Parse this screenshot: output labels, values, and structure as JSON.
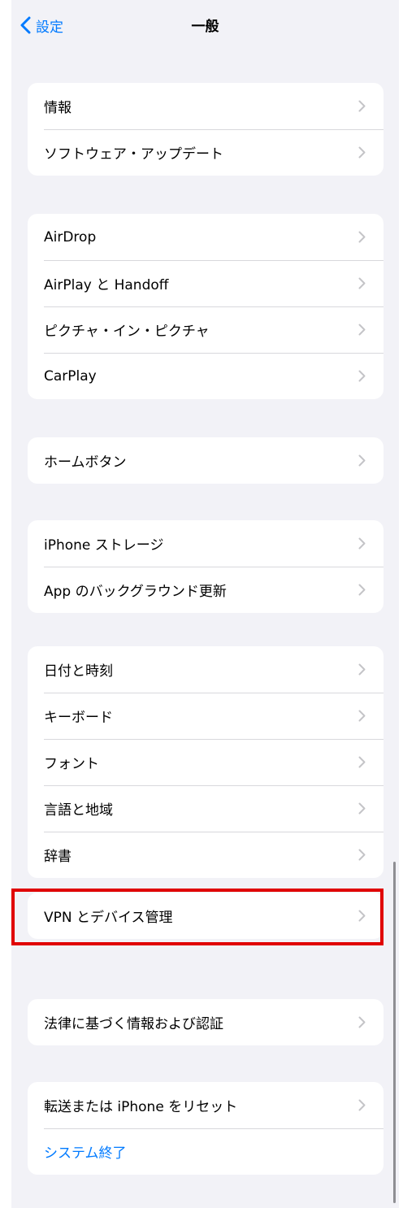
{
  "nav": {
    "back_label": "設定",
    "title": "一般"
  },
  "groups": [
    {
      "items": [
        "情報",
        "ソフトウェア・アップデート"
      ]
    },
    {
      "items": [
        "AirDrop",
        "AirPlay と Handoff",
        "ピクチャ・イン・ピクチャ",
        "CarPlay"
      ]
    },
    {
      "items": [
        "ホームボタン"
      ]
    },
    {
      "items": [
        "iPhone ストレージ",
        "App のバックグラウンド更新"
      ]
    },
    {
      "items": [
        "日付と時刻",
        "キーボード",
        "フォント",
        "言語と地域",
        "辞書"
      ]
    },
    {
      "items": [
        "VPN とデバイス管理"
      ]
    },
    {
      "items": [
        "法律に基づく情報および認証"
      ]
    },
    {
      "items": [
        "転送または iPhone をリセット",
        "システム終了"
      ]
    }
  ],
  "colors": {
    "accent": "#007aff",
    "background": "#f2f2f7",
    "highlight_box": "#e00000"
  },
  "icons": {
    "back": "chevron-left-icon",
    "row_disclosure": "chevron-right-icon"
  }
}
